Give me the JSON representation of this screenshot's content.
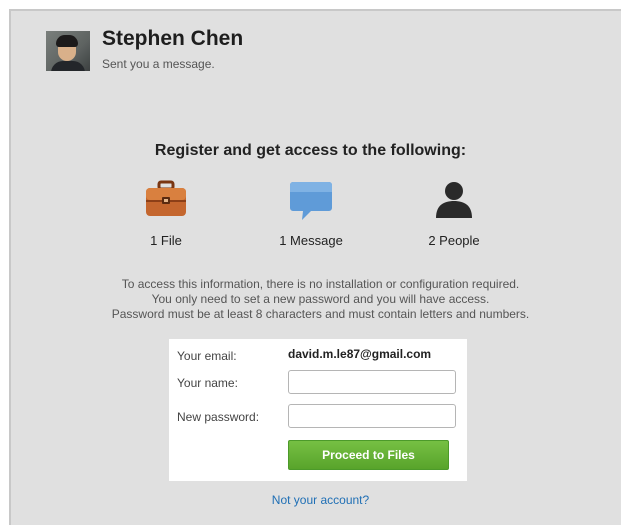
{
  "sender": {
    "name": "Stephen Chen",
    "subtitle": "Sent you a message."
  },
  "headline": "Register and get access to the following:",
  "features": [
    {
      "icon": "briefcase-icon",
      "label": "1 File"
    },
    {
      "icon": "speech-bubble-icon",
      "label": "1 Message"
    },
    {
      "icon": "person-icon",
      "label": "2 People"
    }
  ],
  "info_lines": [
    "To access this information, there is no installation or configuration required.",
    "You only need to set a new password and you will have access.",
    "Password must be at least 8 characters and must contain letters and numbers."
  ],
  "form": {
    "email_label": "Your email:",
    "email_value": "david.m.le87@gmail.com",
    "name_label": "Your name:",
    "name_value": "",
    "password_label": "New password:",
    "password_value": "",
    "submit_label": "Proceed to Files"
  },
  "not_account_link": "Not your account?",
  "colors": {
    "panel_bg": "#e0e0e0",
    "button_green": "#6ab43a",
    "link_blue": "#1f6fb5",
    "briefcase": "#c0622c",
    "bubble": "#5f9bd8",
    "person": "#2a2a2a"
  }
}
